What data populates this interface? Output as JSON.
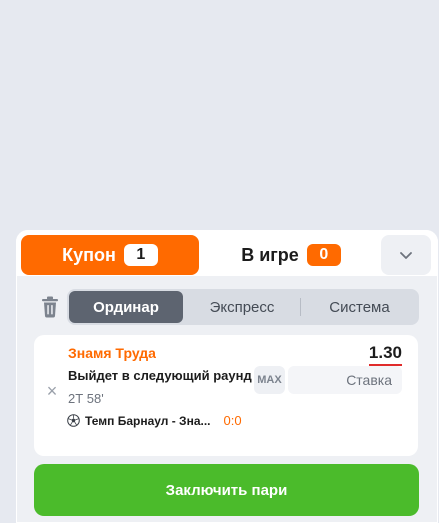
{
  "tabs": {
    "coupon": {
      "label": "Купон",
      "count": "1"
    },
    "in_game": {
      "label": "В игре",
      "count": "0"
    }
  },
  "icons": {
    "collapse": "chevron-down-icon",
    "trash": "trash-icon",
    "remove_bet": "close-icon",
    "sport": "soccer-ball-icon"
  },
  "bet_types": {
    "items": [
      {
        "label": "Ординар",
        "active": true
      },
      {
        "label": "Экспресс",
        "active": false
      },
      {
        "label": "Система",
        "active": false
      }
    ]
  },
  "bet": {
    "team": "Знамя Труда",
    "odds": "1.30",
    "market": "Выйдет в следующий раунд",
    "max_label": "MAX",
    "stake_placeholder": "Ставка",
    "period": "2Т 58'",
    "match": "Темп Барнаул - Зна...",
    "score": "0:0"
  },
  "submit": {
    "label": "Заключить пари"
  },
  "colors": {
    "accent": "#ff6a00",
    "submit": "#4bbb2b",
    "odds_underline": "#e02b2b",
    "active_segment": "#5d6470"
  }
}
